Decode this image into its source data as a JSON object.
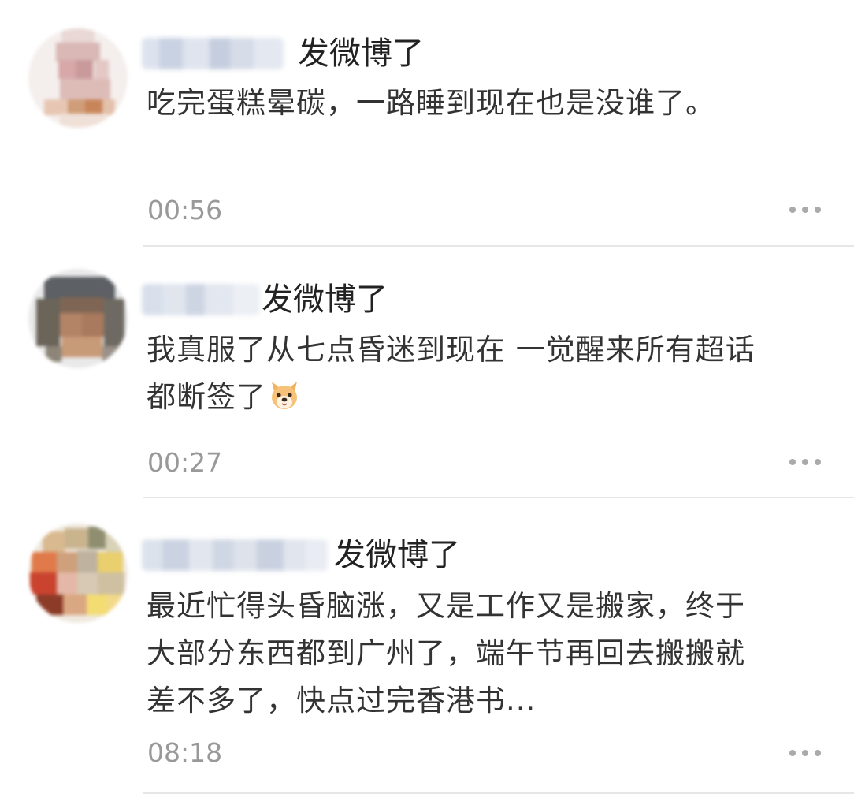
{
  "feed": {
    "posts": [
      {
        "action": "发微博了",
        "text": "吃完蛋糕晕碳，一路睡到现在也是没谁了。",
        "emoji": "",
        "time": "00:56",
        "avatar_desc": "blurred-avatar"
      },
      {
        "action": "发微博了",
        "text": "我真服了从七点昏迷到现在 一觉醒来所有超话都断签了",
        "emoji": "dog-face-emoji",
        "time": "00:27",
        "avatar_desc": "blurred-avatar"
      },
      {
        "action": "发微博了",
        "text": "最近忙得头昏脑涨，又是工作又是搬家，终于大部分东西都到广州了，端午节再回去搬搬就差不多了，快点过完香港书...",
        "emoji": "",
        "time": "08:18",
        "avatar_desc": "blurred-avatar"
      }
    ]
  },
  "icons": {
    "more": "more-horizontal-icon",
    "emoji": "dog-face-emoji"
  },
  "colors": {
    "text": "#333333",
    "action": "#222222",
    "timestamp": "#999999",
    "divider": "#e6e6e6",
    "more_dots": "#aaaaaa",
    "background": "#ffffff"
  }
}
